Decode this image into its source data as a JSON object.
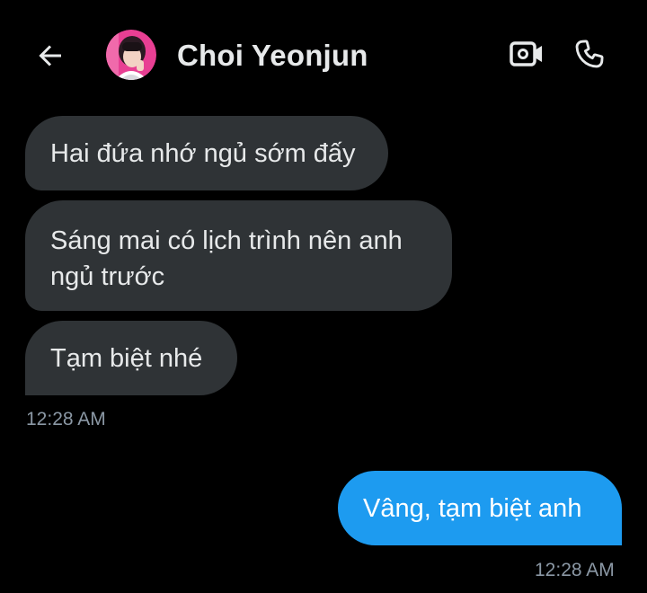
{
  "header": {
    "contact_name": "Choi Yeonjun",
    "back_icon": "arrow-left-icon",
    "video_icon": "video-camera-icon",
    "call_icon": "phone-icon"
  },
  "messages": {
    "incoming": [
      {
        "text": "Hai đứa nhớ ngủ sớm đấy"
      },
      {
        "line1": "Sáng mai có lịch trình nên anh",
        "line2": "ngủ trước"
      },
      {
        "text": "Tạm biệt nhé"
      }
    ],
    "incoming_time": "12:28 AM",
    "outgoing": [
      {
        "text": "Vâng, tạm biệt anh"
      }
    ],
    "outgoing_time": "12:28 AM"
  },
  "colors": {
    "background": "#000000",
    "incoming_bubble": "#2f3336",
    "outgoing_bubble": "#1d9bf0",
    "text_primary": "#e7e9ea",
    "text_secondary": "#8b98a5"
  }
}
